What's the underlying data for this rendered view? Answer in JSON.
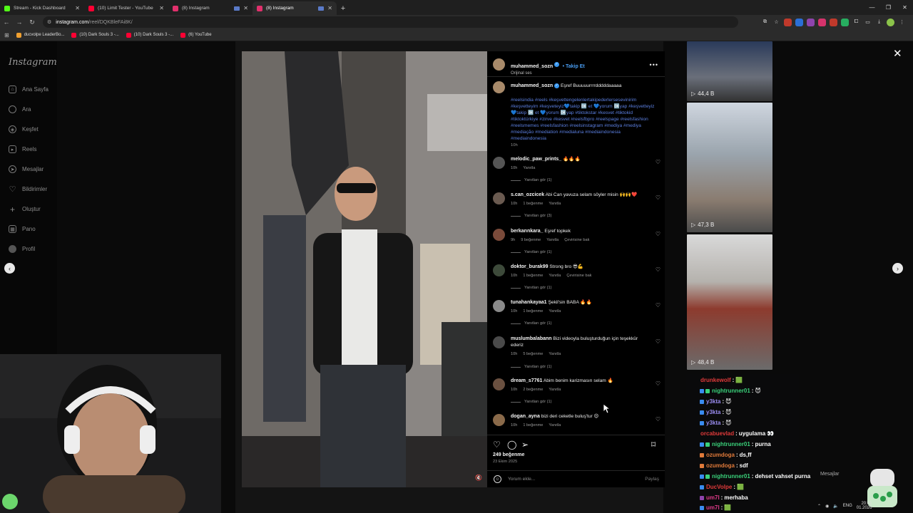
{
  "browser": {
    "tabs": [
      {
        "title": "Stream - Kick Dashboard",
        "favicon_color": "#53fc18",
        "active": false
      },
      {
        "title": "(10) Limit Tester - YouTube",
        "favicon_color": "#ff0033",
        "active": false
      },
      {
        "title": "(8) Instagram",
        "favicon_color": "#e1306c",
        "active": false
      },
      {
        "title": "(8) Instagram",
        "favicon_color": "#e1306c",
        "active": true
      }
    ],
    "new_tab": "+",
    "url": "instagram.com",
    "url_path": "/reel/DQKBleFAi8K/",
    "bookmarks": [
      {
        "label": "ducvolpe LeaderBo...",
        "color": "#f0a030"
      },
      {
        "label": "(10) Dark Souls 3 -...",
        "color": "#ff0033"
      },
      {
        "label": "(10) Dark Souls 3 -...",
        "color": "#ff0033"
      },
      {
        "label": "(6) YouTube",
        "color": "#ff0033"
      }
    ]
  },
  "sidebar": {
    "logo": "Instagram",
    "items": [
      {
        "label": "Ana Sayfa",
        "icon": "⌂"
      },
      {
        "label": "Ara",
        "icon": "⌕"
      },
      {
        "label": "Keşfet",
        "icon": "◎"
      },
      {
        "label": "Reels",
        "icon": "▶"
      },
      {
        "label": "Mesajlar",
        "icon": "➤"
      },
      {
        "label": "Bildirimler",
        "icon": "♡"
      },
      {
        "label": "Oluştur",
        "icon": "+"
      },
      {
        "label": "Pano",
        "icon": "▦"
      },
      {
        "label": "Profil",
        "icon": "●"
      }
    ]
  },
  "post": {
    "author": "muhammed_sozn",
    "follow": "Takip Et",
    "audio": "Orijinal ses",
    "caption_text": "Eşref Buuuuurrrrdddddaaaaa",
    "hashtags": "#reelsindia #reels #keşvettengelenlertakipederlersesevinirim #keşvetteyim #keşveteyiz💙takip 🆗 et 💙yorum 🆗yap #keşvetteyiz💙takip 🆗 et 💙yorum 🆗yap #tiktokstar #kesvet #tiktokid #tiktoktürkiye #zirve #kesvet #reelsfbpro #reelspage #reelsfashion #reelsmemes #reelsfashion #reelsinstagram #mediya #mediya #mediação #mediation #medialuna #mediaindonesia #mediaindonesia",
    "caption_time": "10h",
    "likes": "249 beğenme",
    "date": "23 Ekim 2025",
    "add_comment_placeholder": "Yorum ekle...",
    "share": "Paylaş",
    "comments": [
      {
        "user": "melodic_paw_prints_",
        "text": "🔥🔥🔥",
        "time": "10h",
        "likes": "",
        "reply": "Yanıtla",
        "translate": "",
        "replies": "Yanıtları gör (1)"
      },
      {
        "user": "s.can_ozcicek",
        "text": "Abi Can yavuza selam söyler misin 🙌🙌❤️",
        "time": "10h",
        "likes": "1 beğenme",
        "reply": "Yanıtla",
        "translate": "",
        "replies": "Yanıtları gör (3)"
      },
      {
        "user": "berkannkara_",
        "text": "Eşref topkek",
        "time": "9h",
        "likes": "9 beğenme",
        "reply": "Yanıtla",
        "translate": "Çevirisine bak",
        "replies": "Yanıtları gör (1)"
      },
      {
        "user": "doktor_burak99",
        "text": "Strong bro 😎💪",
        "time": "10h",
        "likes": "1 beğenme",
        "reply": "Yanıtla",
        "translate": "Çevirisine bak",
        "replies": "Yanıtları gör (1)"
      },
      {
        "user": "tunahankayaa1",
        "text": "Şekil'sin BABA 🔥🔥",
        "time": "10h",
        "likes": "1 beğenme",
        "reply": "Yanıtla",
        "translate": "",
        "replies": "Yanıtları gör (1)"
      },
      {
        "user": "muslumbalabann",
        "text": "Bizi videoyla buluşturduğun için teşekkür ederiz",
        "time": "10h",
        "likes": "5 beğenme",
        "reply": "Yanıtla",
        "translate": "",
        "replies": "Yanıtları gör (1)"
      },
      {
        "user": "dream_s7761",
        "text": "Abim benim karizmasın selam 🔥",
        "time": "10h",
        "likes": "2 beğenme",
        "reply": "Yanıtla",
        "translate": "",
        "replies": "Yanıtları gör (1)"
      },
      {
        "user": "dogan_ayna",
        "text": "bizi deri ceketle buluş'tur 😍",
        "time": "10h",
        "likes": "1 beğenme",
        "reply": "Yanıtla",
        "translate": "",
        "replies": ""
      }
    ]
  },
  "explore": {
    "views": [
      "44,4 B",
      "47,3 B",
      "48,4 B"
    ]
  },
  "chat": {
    "messages": [
      {
        "user": "drunkewolf",
        "text": "🟩",
        "color": "#e03a3a"
      },
      {
        "user": "nightrunner01",
        "text": "😈",
        "color": "#3ad17a"
      },
      {
        "user": "y3kta",
        "text": "😈",
        "color": "#9a8cf0"
      },
      {
        "user": "y3kta",
        "text": "😈",
        "color": "#9a8cf0"
      },
      {
        "user": "y3kta",
        "text": "😈",
        "color": "#9a8cf0"
      },
      {
        "user": "orcabuevlad",
        "text": "uygulama 👀",
        "color": "#e03a3a"
      },
      {
        "user": "nightrunner01",
        "text": "purna",
        "color": "#3ad17a"
      },
      {
        "user": "ozumdoga",
        "text": "ds,ff",
        "color": "#e07a3a"
      },
      {
        "user": "ozumdoga",
        "text": "sdf",
        "color": "#e07a3a"
      },
      {
        "user": "nightrunner01",
        "text": "dehset vahset purna",
        "color": "#3ad17a"
      },
      {
        "user": "DucVolpe",
        "text": "🟩",
        "color": "#e03a3a"
      },
      {
        "user": "um7l",
        "text": "merhaba",
        "color": "#e03a8a"
      },
      {
        "user": "um7l",
        "text": "🟩",
        "color": "#e03a8a"
      }
    ],
    "messages_button": "Mesajlar"
  },
  "tray": {
    "lang": "ENG",
    "time": "20:01",
    "date": "01.2026"
  },
  "colors": {
    "accent_blue": "#4a9ff5",
    "hashtag": "#5b7fe0",
    "panel_bg": "#000000"
  }
}
